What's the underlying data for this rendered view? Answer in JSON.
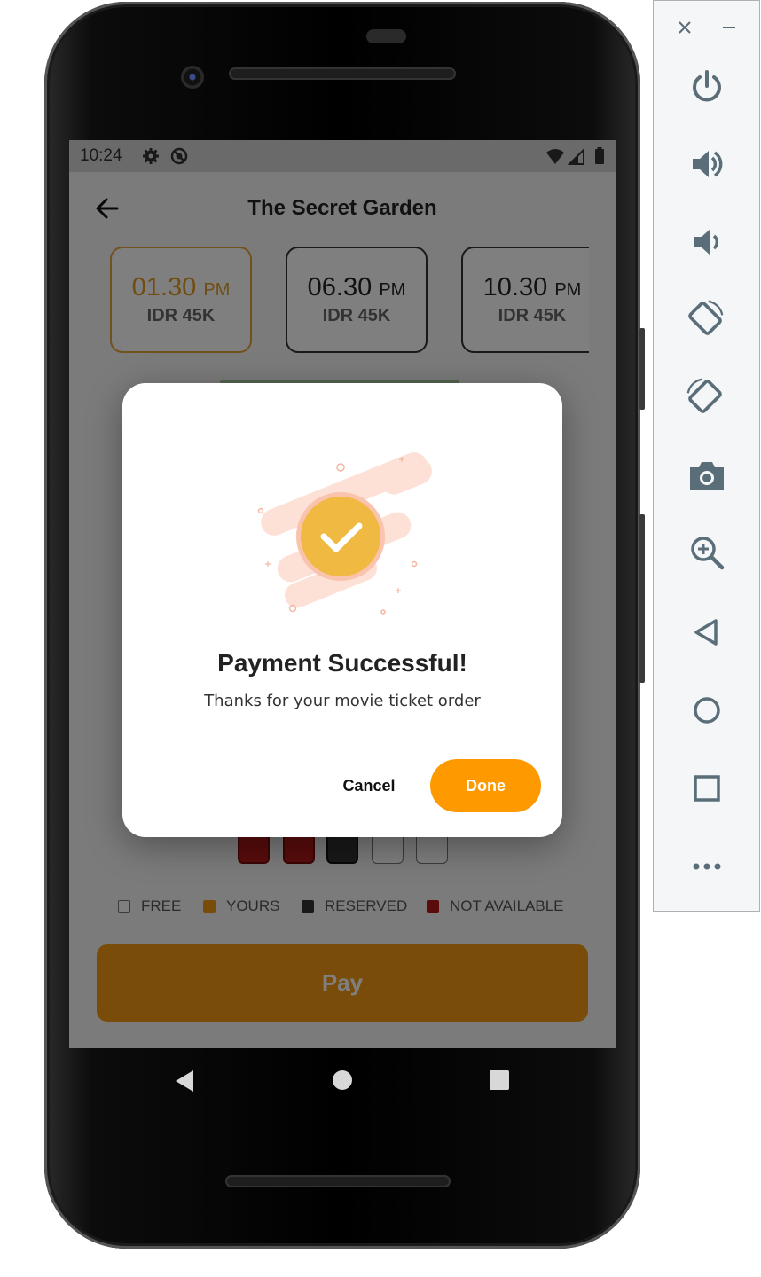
{
  "status_bar": {
    "time": "10:24"
  },
  "app_bar": {
    "title": "The Secret Garden"
  },
  "showtimes": [
    {
      "time": "01.30",
      "ampm": "PM",
      "price": "IDR 45K",
      "selected": true
    },
    {
      "time": "06.30",
      "ampm": "PM",
      "price": "IDR 45K",
      "selected": false
    },
    {
      "time": "10.30",
      "ampm": "PM",
      "price": "IDR 45K",
      "selected": false
    }
  ],
  "legend": {
    "free": "FREE",
    "yours": "YOURS",
    "reserved": "RESERVED",
    "not_available": "NOT AVAILABLE"
  },
  "pay_button": {
    "label": "Pay"
  },
  "dialog": {
    "title": "Payment Successful!",
    "message": "Thanks for your movie ticket order",
    "cancel_label": "Cancel",
    "done_label": "Done"
  },
  "colors": {
    "accent": "#ff9900",
    "selected_time": "#e09a20",
    "check_circle": "#f0b942",
    "not_available": "#b51818",
    "reserved": "#333333"
  },
  "toolbar": {
    "icons": [
      "close-icon",
      "minimize-icon",
      "power-icon",
      "volume-up-icon",
      "volume-down-icon",
      "rotate-left-icon",
      "rotate-right-icon",
      "camera-icon",
      "zoom-icon",
      "back-icon",
      "home-icon",
      "overview-icon",
      "more-icon"
    ]
  }
}
